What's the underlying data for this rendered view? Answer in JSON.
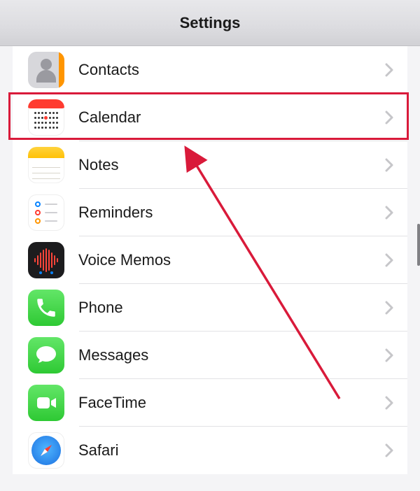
{
  "header": {
    "title": "Settings"
  },
  "items": [
    {
      "id": "contacts",
      "label": "Contacts",
      "icon": "contacts-icon"
    },
    {
      "id": "calendar",
      "label": "Calendar",
      "icon": "calendar-icon"
    },
    {
      "id": "notes",
      "label": "Notes",
      "icon": "notes-icon"
    },
    {
      "id": "reminders",
      "label": "Reminders",
      "icon": "reminders-icon"
    },
    {
      "id": "voicememos",
      "label": "Voice Memos",
      "icon": "voice-memos-icon"
    },
    {
      "id": "phone",
      "label": "Phone",
      "icon": "phone-icon"
    },
    {
      "id": "messages",
      "label": "Messages",
      "icon": "messages-icon"
    },
    {
      "id": "facetime",
      "label": "FaceTime",
      "icon": "facetime-icon"
    },
    {
      "id": "safari",
      "label": "Safari",
      "icon": "safari-icon"
    }
  ],
  "annotation": {
    "highlighted_item": "calendar",
    "highlight_color": "#d91a3a"
  }
}
